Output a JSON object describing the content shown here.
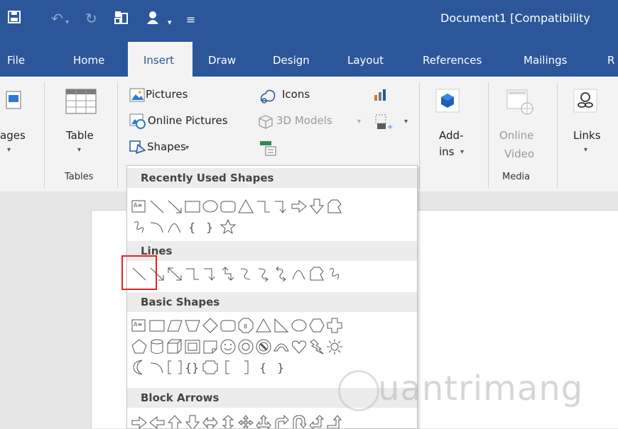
{
  "title_bar": {
    "document_title": "Document1 [Compatibility",
    "icons": [
      "save-icon",
      "undo-icon",
      "redo-icon",
      "touch-mode-icon",
      "account-icon",
      "qat-dropdown-icon",
      "customize-qat-icon"
    ]
  },
  "tabs": [
    "File",
    "Home",
    "Insert",
    "Draw",
    "Design",
    "Layout",
    "References",
    "Mailings",
    "R"
  ],
  "active_tab": "Insert",
  "ribbon": {
    "pages_label": "ages",
    "table": {
      "label": "Table",
      "group": "Tables"
    },
    "illustrations": {
      "pictures": "Pictures",
      "online_pictures": "Online Pictures",
      "shapes": "Shapes",
      "icons": "Icons",
      "models_3d": "3D Models"
    },
    "addins": {
      "label_line1": "Add-",
      "label_line2": "ins"
    },
    "online_video": {
      "label_line1": "Online",
      "label_line2": "Video",
      "group": "Media"
    },
    "links": {
      "label": "Links"
    }
  },
  "shapes_menu": {
    "sections": [
      "Recently Used Shapes",
      "Lines",
      "Basic Shapes",
      "Block Arrows"
    ]
  },
  "watermark": "uantrimang",
  "colors": {
    "accent": "#2b579a",
    "highlight": "#e82222"
  }
}
